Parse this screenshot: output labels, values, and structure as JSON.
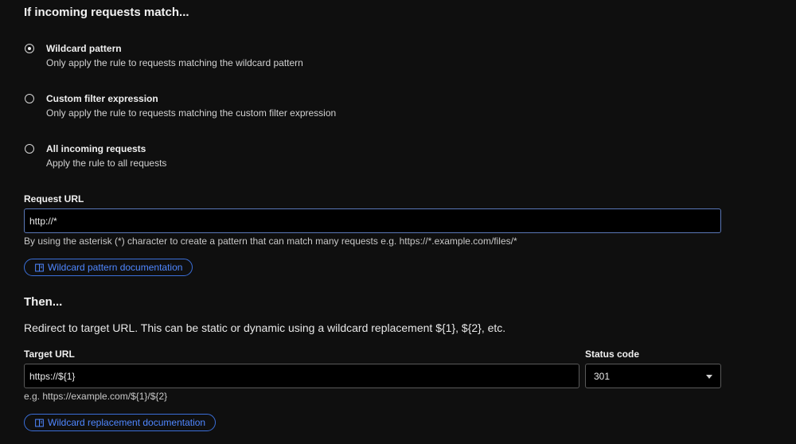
{
  "match_section": {
    "title": "If incoming requests match...",
    "options": [
      {
        "label": "Wildcard pattern",
        "description": "Only apply the rule to requests matching the wildcard pattern",
        "selected": true
      },
      {
        "label": "Custom filter expression",
        "description": "Only apply the rule to requests matching the custom filter expression",
        "selected": false
      },
      {
        "label": "All incoming requests",
        "description": "Apply the rule to all requests",
        "selected": false
      }
    ]
  },
  "request_url": {
    "label": "Request URL",
    "value": "http://*",
    "hint": "By using the asterisk (*) character to create a pattern that can match many requests e.g. https://*.example.com/files/*",
    "doc_button": "Wildcard pattern documentation"
  },
  "then_section": {
    "title": "Then...",
    "description": "Redirect to target URL. This can be static or dynamic using a wildcard replacement ${1}, ${2}, etc."
  },
  "target_url": {
    "label": "Target URL",
    "value": "https://${1}",
    "hint": "e.g. https://example.com/${1}/${2}",
    "doc_button": "Wildcard replacement documentation"
  },
  "status_code": {
    "label": "Status code",
    "value": "301"
  },
  "colors": {
    "background": "#0f0f0f",
    "accent": "#4f87ff",
    "active_border": "#5b78b8"
  }
}
